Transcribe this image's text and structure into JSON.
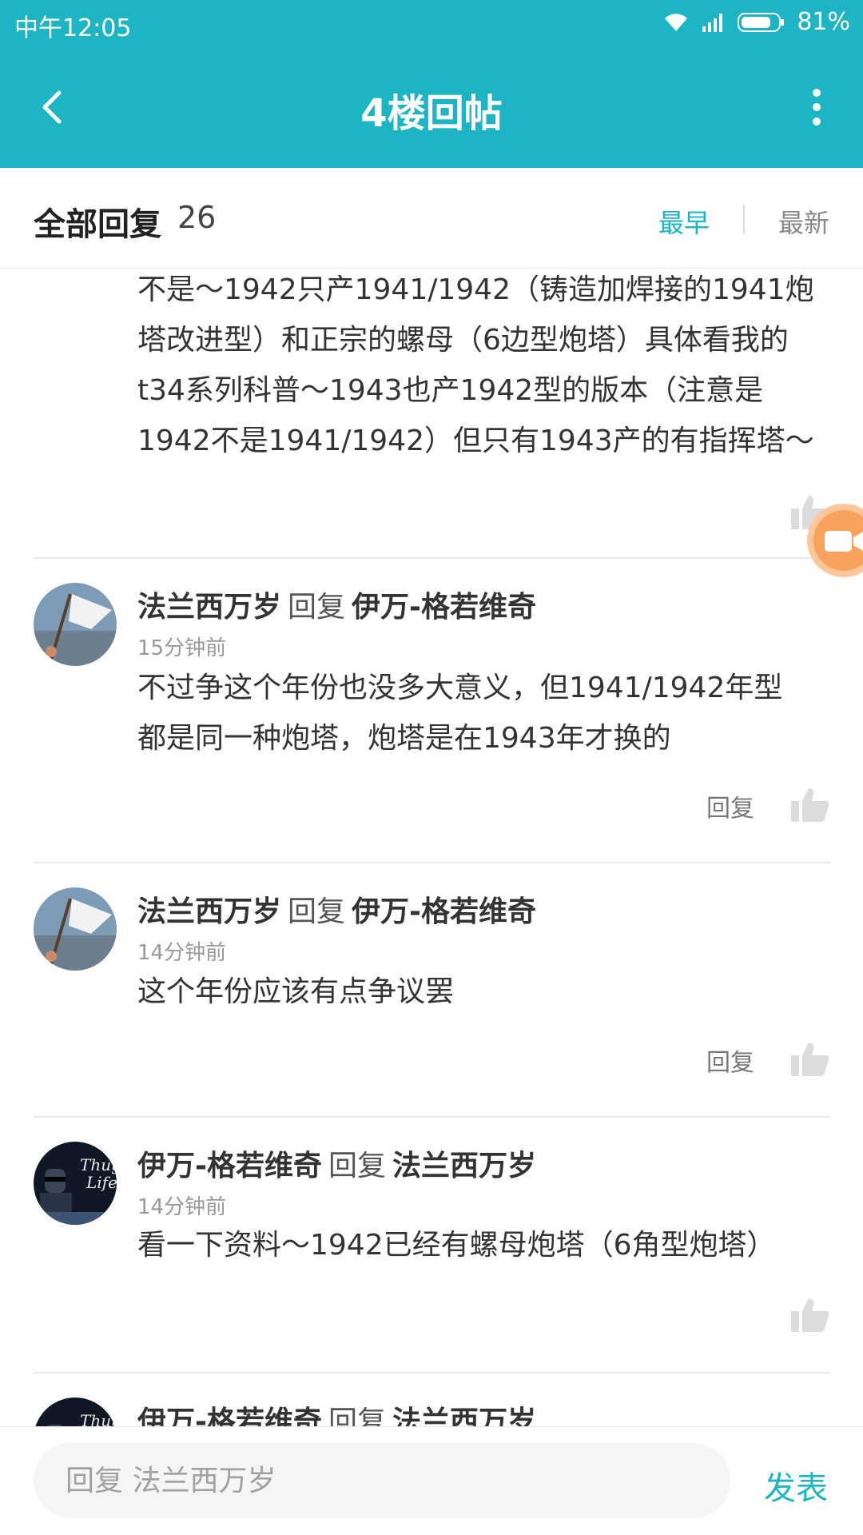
{
  "status_bar": {
    "time": "中午12:05",
    "battery_percent": "81%",
    "battery_level": 0.81
  },
  "header": {
    "title": "4楼回帖"
  },
  "sort_bar": {
    "label": "全部回复",
    "count": "26",
    "earliest": "最早",
    "newest": "最新"
  },
  "partial_reply": {
    "lines": [
      "不是～1942只产1941/1942（铸造加焊接的1941炮",
      "塔改进型）和正宗的螺母（6边型炮塔）具体看我的",
      "t34系列科普～1943也产1942型的版本（注意是",
      "1942不是1941/1942）但只有1943产的有指挥塔～"
    ]
  },
  "replies": [
    {
      "author": "法兰西万岁",
      "verb": "回复",
      "target": "伊万-格若维奇",
      "time": "15分钟前",
      "lines": [
        "不过争这个年份也没多大意义，但1941/1942年型",
        "都是同一种炮塔，炮塔是在1943年才换的"
      ],
      "reply_label": "回复"
    },
    {
      "author": "法兰西万岁",
      "verb": "回复",
      "target": "伊万-格若维奇",
      "time": "14分钟前",
      "lines": [
        "这个年份应该有点争议罢"
      ],
      "reply_label": "回复"
    },
    {
      "author": "伊万-格若维奇",
      "verb": "回复",
      "target": "法兰西万岁",
      "time": "14分钟前",
      "lines": [
        "看一下资料～1942已经有螺母炮塔（6角型炮塔）"
      ]
    },
    {
      "author": "伊万-格若维奇",
      "verb": "回复",
      "target": "法兰西万岁"
    }
  ],
  "avatars": {
    "thug_life_text_1": "Thug",
    "thug_life_text_2": "Life"
  },
  "bottom_bar": {
    "placeholder": "回复 法兰西万岁",
    "send": "发表"
  },
  "colors": {
    "accent": "#1db5c4",
    "float_button": "#f7a35e"
  }
}
